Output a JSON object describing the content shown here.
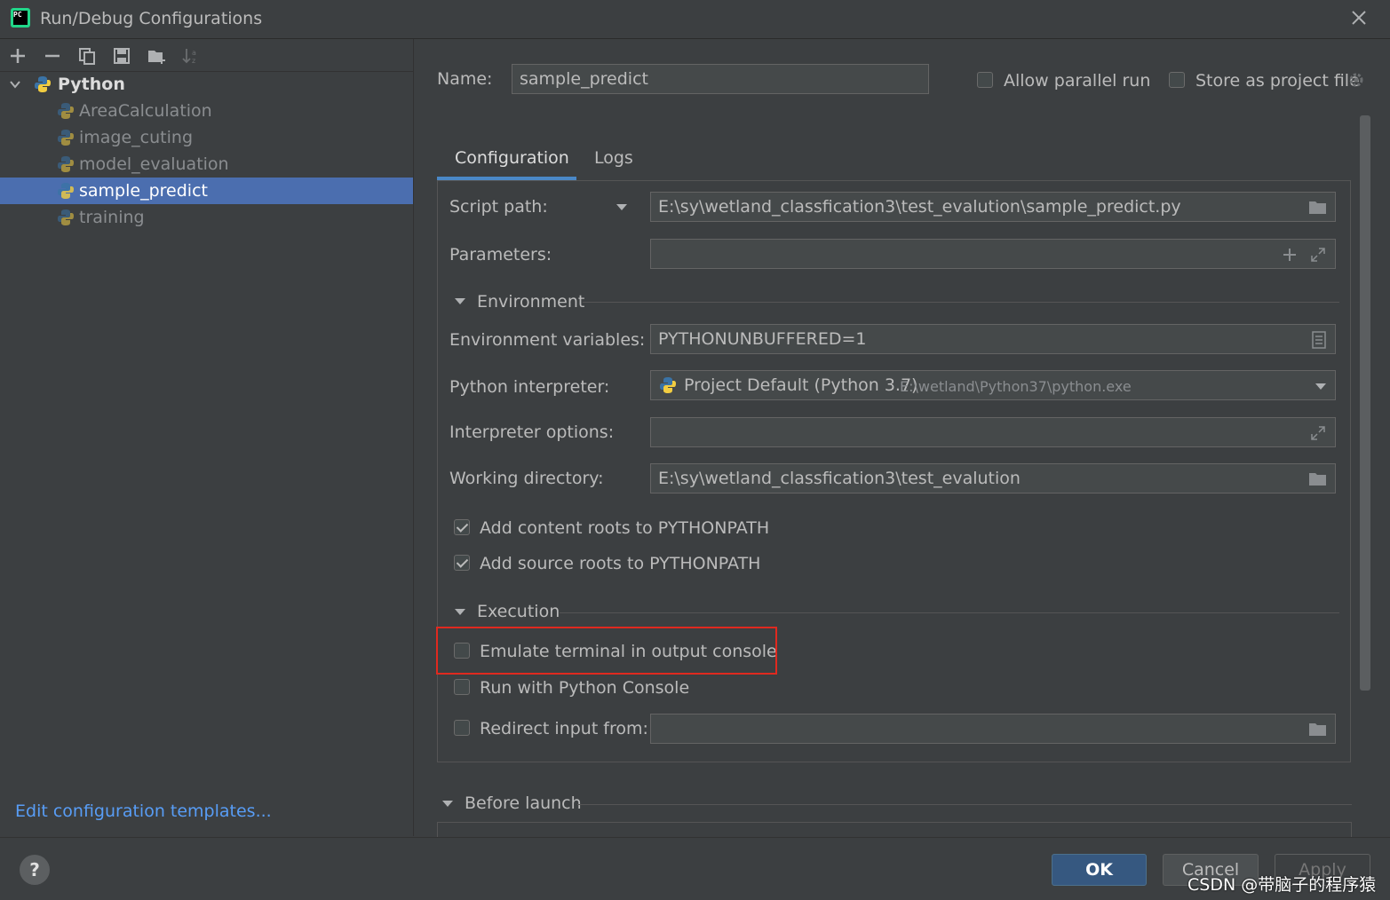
{
  "window": {
    "title": "Run/Debug Configurations"
  },
  "tree": {
    "root_label": "Python",
    "items": [
      {
        "label": "AreaCalculation",
        "selected": false
      },
      {
        "label": "image_cuting",
        "selected": false
      },
      {
        "label": "model_evaluation",
        "selected": false
      },
      {
        "label": "sample_predict",
        "selected": true
      },
      {
        "label": "training",
        "selected": false
      }
    ],
    "edit_templates_link": "Edit configuration templates..."
  },
  "header": {
    "name_label": "Name:",
    "name_value": "sample_predict",
    "allow_parallel_label": "Allow parallel run",
    "store_as_project_label": "Store as project file"
  },
  "tabs": [
    {
      "label": "Configuration",
      "active": true
    },
    {
      "label": "Logs",
      "active": false
    }
  ],
  "config": {
    "script_path_label": "Script path:",
    "script_path_value": "E:\\sy\\wetland_classfication3\\test_evalution\\sample_predict.py",
    "parameters_label": "Parameters:",
    "parameters_value": "",
    "environment_section": "Environment",
    "env_vars_label": "Environment variables:",
    "env_vars_value": "PYTHONUNBUFFERED=1",
    "interpreter_label": "Python interpreter:",
    "interpreter_value": "Project Default (Python 3.7)",
    "interpreter_path": "E:\\wetland\\Python37\\python.exe",
    "interpreter_options_label": "Interpreter options:",
    "interpreter_options_value": "",
    "working_dir_label": "Working directory:",
    "working_dir_value": "E:\\sy\\wetland_classfication3\\test_evalution",
    "add_content_roots_label": "Add content roots to PYTHONPATH",
    "add_content_roots_checked": true,
    "add_source_roots_label": "Add source roots to PYTHONPATH",
    "add_source_roots_checked": true,
    "execution_section": "Execution",
    "emulate_terminal_label": "Emulate terminal in output console",
    "emulate_terminal_checked": false,
    "run_python_console_label": "Run with Python Console",
    "run_python_console_checked": false,
    "redirect_input_label": "Redirect input from:",
    "redirect_input_checked": false,
    "redirect_input_value": ""
  },
  "before_launch": {
    "label": "Before launch"
  },
  "buttons": {
    "ok": "OK",
    "cancel": "Cancel",
    "apply": "Apply",
    "help": "?"
  },
  "watermark": "CSDN @带脑子的程序猿",
  "colors": {
    "selection": "#4b6eaf",
    "accent_tab": "#4a88c7",
    "highlight_box": "#e0291f",
    "link": "#589df6"
  }
}
